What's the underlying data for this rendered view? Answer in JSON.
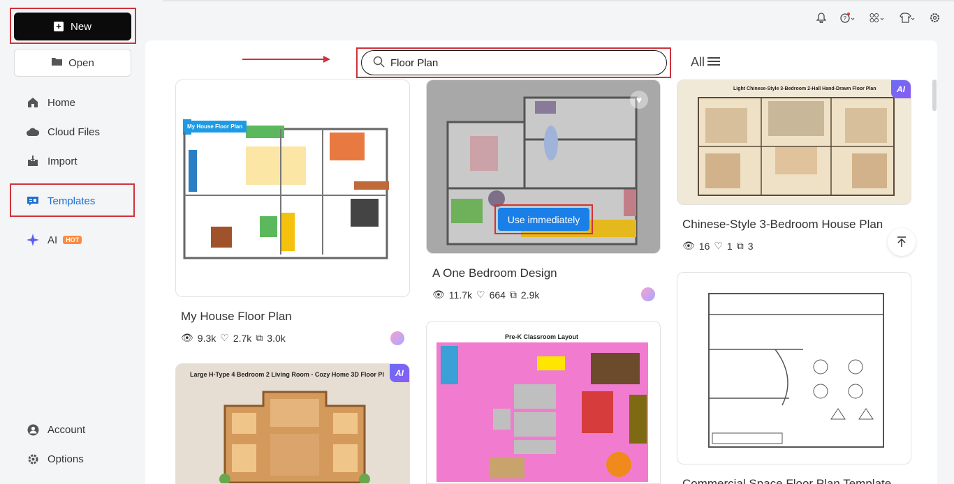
{
  "sidebar": {
    "new_label": "New",
    "open_label": "Open",
    "items": [
      {
        "label": "Home",
        "icon": "home-icon"
      },
      {
        "label": "Cloud Files",
        "icon": "cloud-icon"
      },
      {
        "label": "Import",
        "icon": "import-icon"
      },
      {
        "label": "Templates",
        "icon": "templates-icon"
      },
      {
        "label": "AI",
        "icon": "sparkle-icon",
        "badge": "HOT"
      }
    ],
    "bottom_items": [
      {
        "label": "Account",
        "icon": "account-icon"
      },
      {
        "label": "Options",
        "icon": "gear-icon"
      }
    ]
  },
  "search": {
    "value": "Floor Plan",
    "filter_label": "All"
  },
  "cards": {
    "c1": {
      "title": "My House Floor Plan",
      "views": "9.3k",
      "likes": "2.7k",
      "copies": "3.0k",
      "thumb_label": "My House Floor Plan"
    },
    "c2": {
      "title": "A One Bedroom Design",
      "views": "11.7k",
      "likes": "664",
      "copies": "2.9k",
      "action": "Use immediately"
    },
    "c3": {
      "title": "Chinese-Style 3-Bedroom House Plan",
      "views": "16",
      "likes": "1",
      "copies": "3",
      "thumb_label": "Light Chinese-Style 3-Bedroom 2-Hall Hand-Drawn Floor Plan",
      "badge": "AI"
    },
    "c4": {
      "thumb_label": "Large H-Type 4 Bedroom 2 Living Room - Cozy Home 3D Floor Pl",
      "badge": "AI"
    },
    "c5": {
      "thumb_label": "Pre-K Classroom Layout"
    },
    "c6": {
      "title": "Commercial Space Floor Plan Template"
    }
  },
  "colors": {
    "accent": "#1a7fe6",
    "highlight": "#d0323a",
    "new_button": "#0b0b0b",
    "hot_badge": "#ff8a3d"
  }
}
